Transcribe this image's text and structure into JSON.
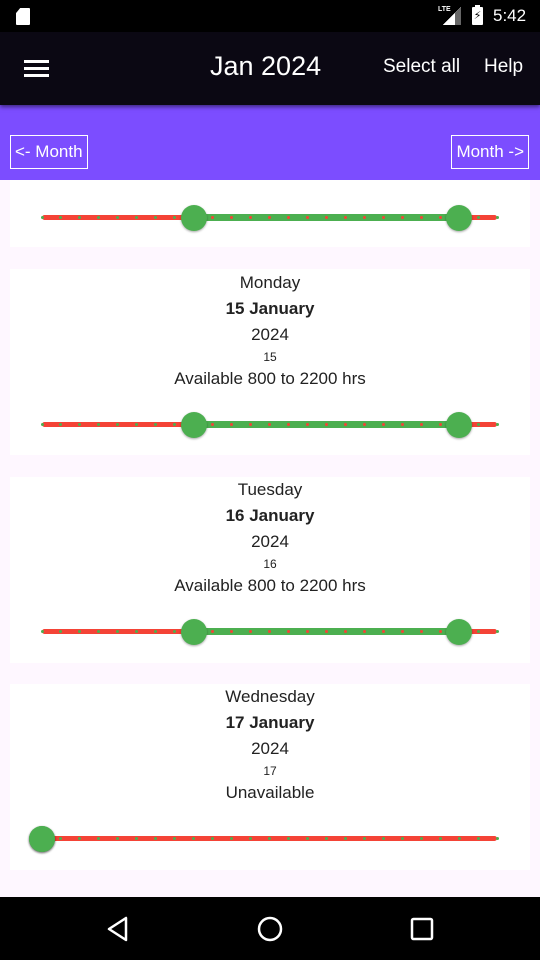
{
  "status_bar": {
    "time": "5:42",
    "network": "LTE",
    "icons": [
      "sd-card-icon",
      "lte-signal-icon",
      "battery-charging-icon"
    ]
  },
  "app_bar": {
    "menu_icon": "menu-icon",
    "title": "Jan 2024",
    "actions": {
      "select_all": "Select all",
      "help": "Help"
    }
  },
  "month_nav": {
    "prev_label": "<- Month",
    "next_label": "Month ->"
  },
  "colors": {
    "accent": "#7c4dff",
    "available": "#4caf50",
    "unavailable": "#f44336",
    "app_bar": "#0b0813"
  },
  "slider_range": {
    "min": 0,
    "max": 24,
    "step": 1
  },
  "days": [
    {
      "partial": true,
      "weekday": "",
      "date": "",
      "year": "",
      "day_num": "",
      "status": "",
      "range": [
        8,
        22
      ]
    },
    {
      "partial": false,
      "weekday": "Monday",
      "date": "15 January",
      "year": "2024",
      "day_num": "15",
      "status": "Available 800 to 2200 hrs",
      "range": [
        8,
        22
      ]
    },
    {
      "partial": false,
      "weekday": "Tuesday",
      "date": "16 January",
      "year": "2024",
      "day_num": "16",
      "status": "Available 800 to 2200 hrs",
      "range": [
        8,
        22
      ]
    },
    {
      "partial": false,
      "weekday": "Wednesday",
      "date": "17 January",
      "year": "2024",
      "day_num": "17",
      "status": "Unavailable",
      "range": [
        0,
        0
      ]
    }
  ],
  "nav_bar": {
    "buttons": [
      "back",
      "home",
      "recents"
    ]
  }
}
